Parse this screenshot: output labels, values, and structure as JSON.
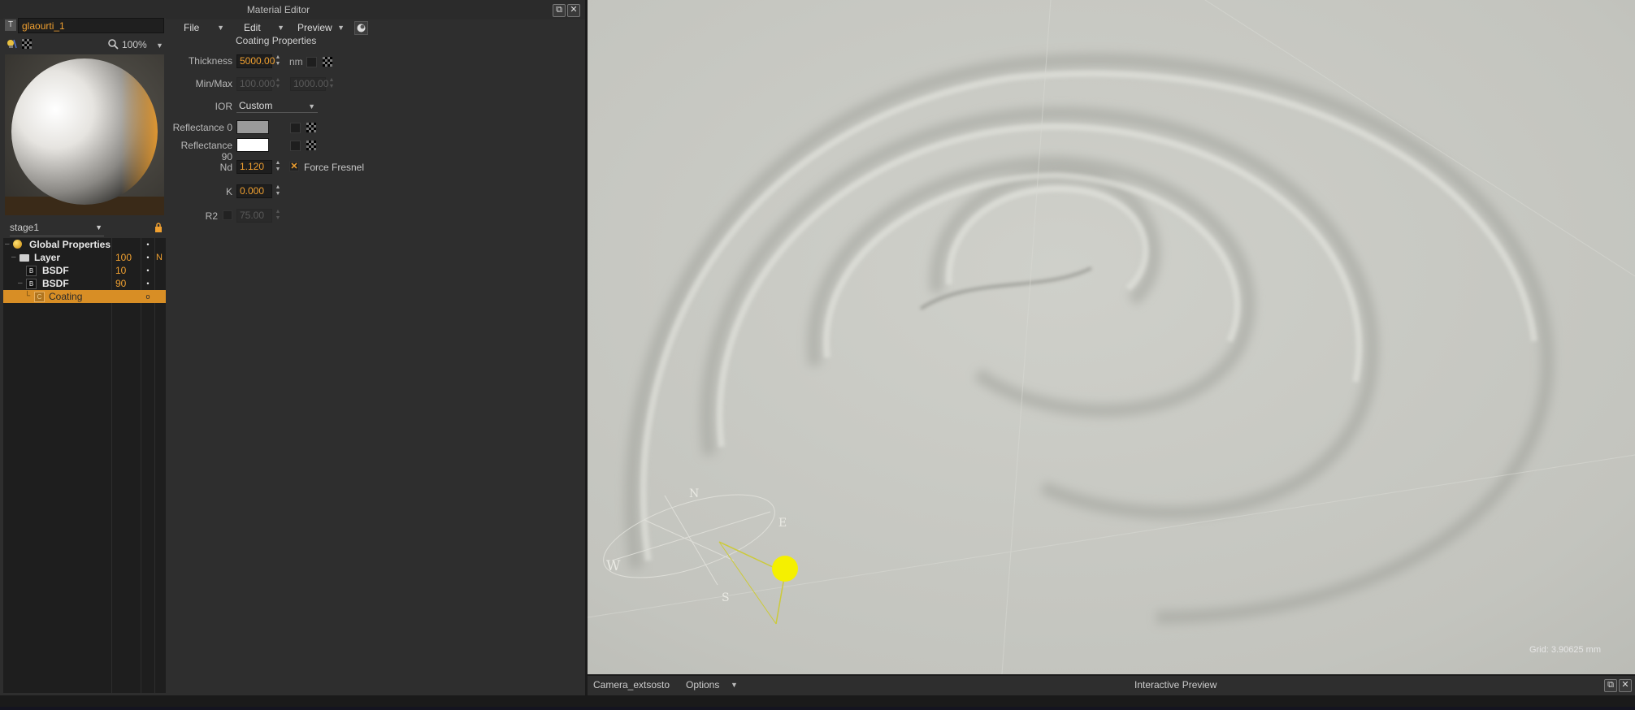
{
  "editor": {
    "title": "Material Editor",
    "restore_label": "⧉",
    "close_label": "✕",
    "material_name": "glaourti_1",
    "type_icon_label": "T",
    "zoom": "100%",
    "stage": "stage1",
    "menus": [
      {
        "label": "File"
      },
      {
        "label": "Edit"
      },
      {
        "label": "Preview"
      }
    ],
    "tree": [
      {
        "label": "Global Properties",
        "col_a": "",
        "col_b": "•",
        "col_c": ""
      },
      {
        "label": "Layer",
        "col_a": "100",
        "col_b": "•",
        "col_c": "N"
      },
      {
        "label": "BSDF",
        "col_a": "10",
        "col_b": "•",
        "col_c": ""
      },
      {
        "label": "BSDF",
        "col_a": "90",
        "col_b": "•",
        "col_c": ""
      },
      {
        "label": "Coating",
        "col_a": "",
        "col_b": "o",
        "col_c": ""
      }
    ],
    "badges": {
      "b": "B",
      "c": "C"
    },
    "coating": {
      "title": "Coating Properties",
      "thickness_label": "Thickness",
      "thickness_value": "5000.00",
      "thickness_unit": "nm",
      "minmax_label": "Min/Max",
      "min_value": "100.000",
      "max_value": "1000.00",
      "ior_label": "IOR",
      "ior_value": "Custom",
      "refl0_label": "Reflectance 0",
      "refl0_color": "#9a9a9a",
      "refl90_label": "Reflectance 90",
      "refl90_color": "#ffffff",
      "nd_label": "Nd",
      "nd_value": "1.120",
      "force_fresnel_label": "Force Fresnel",
      "force_fresnel_checked": true,
      "k_label": "K",
      "k_value": "0.000",
      "r2_label": "R2",
      "r2_value": "75.00"
    }
  },
  "viewport": {
    "grid_readout": "Grid: 3.90625 mm",
    "camera": "Camera_extsosto",
    "options": "Options",
    "title": "Interactive Preview",
    "light_color": "#f5f000",
    "compass": {
      "n": "N",
      "e": "E",
      "s": "S",
      "w": "W"
    }
  },
  "colors": {
    "accent": "#f0a030",
    "selection": "#d88e25",
    "panel": "#2e2e2e",
    "viewport_bg": "#c4c5bf"
  }
}
